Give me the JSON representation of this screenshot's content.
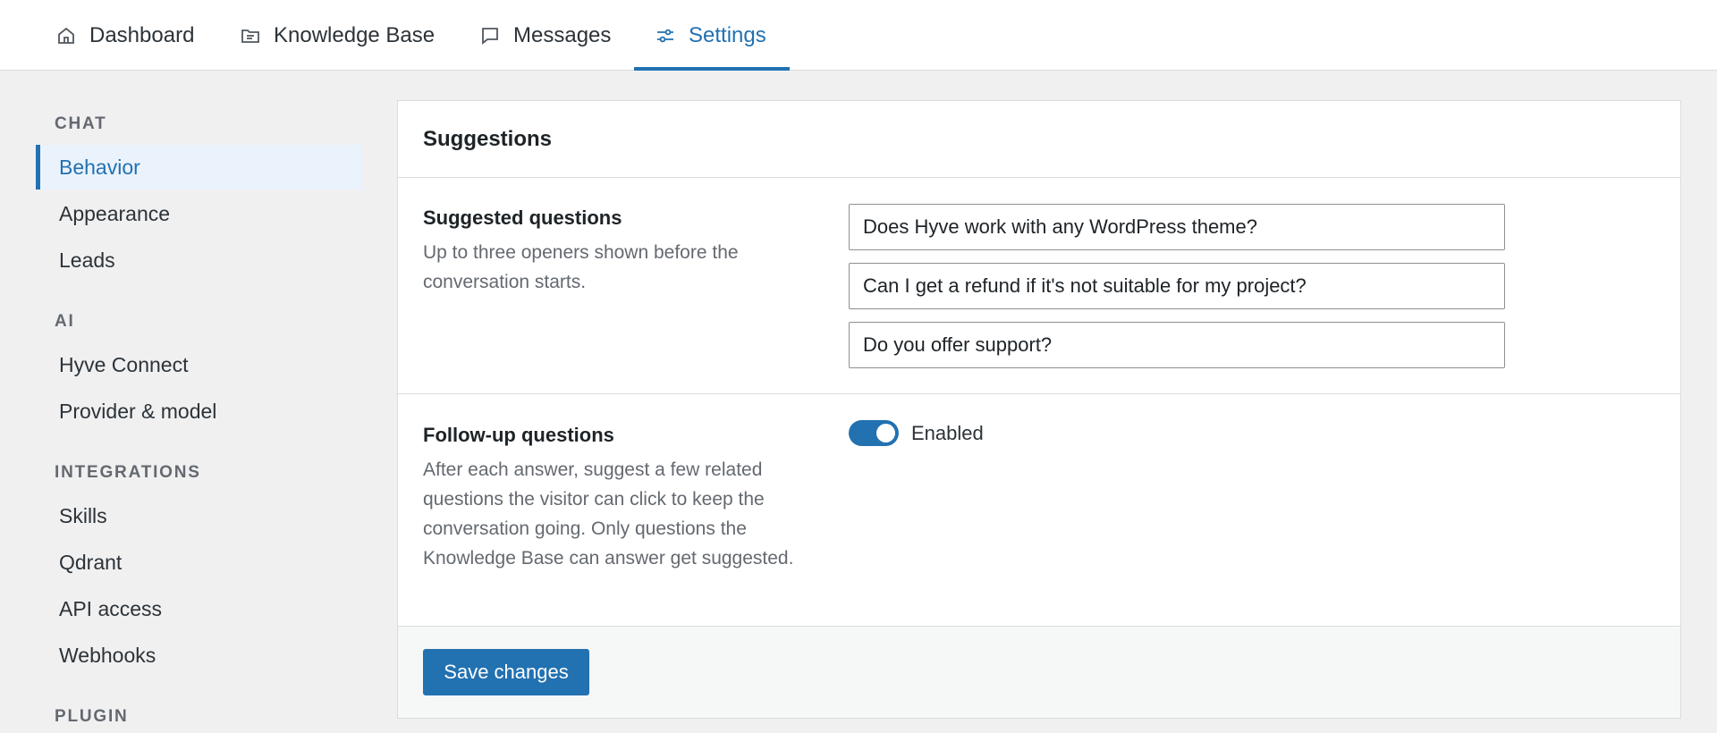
{
  "topnav": {
    "tabs": [
      {
        "label": "Dashboard",
        "icon": "home-icon"
      },
      {
        "label": "Knowledge Base",
        "icon": "folder-icon"
      },
      {
        "label": "Messages",
        "icon": "message-icon"
      },
      {
        "label": "Settings",
        "icon": "sliders-icon",
        "active": true
      }
    ]
  },
  "sidebar": {
    "sections": [
      {
        "heading": "CHAT",
        "items": [
          "Behavior",
          "Appearance",
          "Leads"
        ]
      },
      {
        "heading": "AI",
        "items": [
          "Hyve Connect",
          "Provider & model"
        ]
      },
      {
        "heading": "INTEGRATIONS",
        "items": [
          "Skills",
          "Qdrant",
          "API access",
          "Webhooks"
        ]
      },
      {
        "heading": "PLUGIN",
        "items": []
      }
    ],
    "active_item": "Behavior"
  },
  "card": {
    "title": "Suggestions",
    "suggested": {
      "title": "Suggested questions",
      "description": "Up to three openers shown before the conversation starts.",
      "questions": [
        "Does Hyve work with any WordPress theme?",
        "Can I get a refund if it's not suitable for my project?",
        "Do you offer support?"
      ]
    },
    "followup": {
      "title": "Follow-up questions",
      "description": "After each answer, suggest a few related questions the visitor can click to keep the conversation going. Only questions the Knowledge Base can answer get suggested.",
      "toggle_label": "Enabled",
      "enabled": true
    },
    "save_label": "Save changes"
  },
  "colors": {
    "accent": "#2271b1",
    "active_bg": "#eaf3fc",
    "page_bg": "#f0f0f1"
  }
}
